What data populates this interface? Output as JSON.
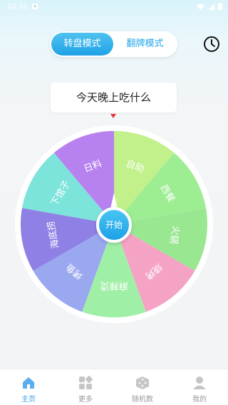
{
  "status_bar": {
    "time": "10:32"
  },
  "mode_toggle": {
    "active": "转盘模式",
    "inactive": "翻牌模式"
  },
  "title": "今天晚上吃什么",
  "wheel": {
    "start_label": "开始",
    "segments": [
      {
        "label": "自助",
        "color": "#c2f08a"
      },
      {
        "label": "西餐",
        "color": "#9ded93"
      },
      {
        "label": "火锅",
        "color": "#9ae792"
      },
      {
        "label": "烧烤",
        "color": "#f4a3c4"
      },
      {
        "label": "麻辣烫",
        "color": "#a0efa7"
      },
      {
        "label": "烤鱼",
        "color": "#9aa8f0"
      },
      {
        "label": "海底捞",
        "color": "#8f80e5"
      },
      {
        "label": "下馆子",
        "color": "#7de4db"
      },
      {
        "label": "日料",
        "color": "#b782ef"
      }
    ]
  },
  "bottom_nav": [
    {
      "label": "主页",
      "icon": "home-icon",
      "active": true
    },
    {
      "label": "更多",
      "icon": "grid-icon",
      "active": false
    },
    {
      "label": "随机数",
      "icon": "dice-icon",
      "active": false
    },
    {
      "label": "我的",
      "icon": "user-icon",
      "active": false
    }
  ],
  "colors": {
    "accent": "#25a7e8",
    "pointer": "#e53935"
  }
}
